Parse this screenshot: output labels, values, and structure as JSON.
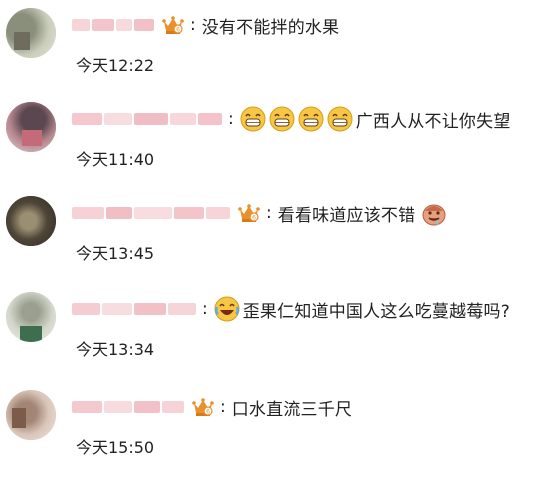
{
  "comments": [
    {
      "text": "没有不能拌的水果",
      "time": "今天12:22",
      "badge": "vip-crown-icon",
      "emojis": []
    },
    {
      "text": "广西人从不让你失望",
      "time": "今天11:40",
      "badge": "",
      "emojis": [
        "grin-emoji",
        "grin-emoji",
        "grin-emoji",
        "grin-emoji"
      ]
    },
    {
      "text": "看看味道应该不错",
      "time": "今天13:45",
      "badge": "vip-crown-icon",
      "emojis": [],
      "trailing_emoji": "drooling-emoji"
    },
    {
      "text": "歪果仁知道中国人这么吃蔓越莓吗?",
      "time": "今天13:34",
      "badge": "",
      "emojis": [
        "laugh-cry-emoji"
      ]
    },
    {
      "text": "口水直流三千尺",
      "time": "今天15:50",
      "badge": "vip-crown-icon",
      "emojis": []
    }
  ],
  "colors": {
    "name_blur": "#f4c6cc",
    "crown": "#e0892b",
    "emoji_yellow": "#f6c744"
  }
}
